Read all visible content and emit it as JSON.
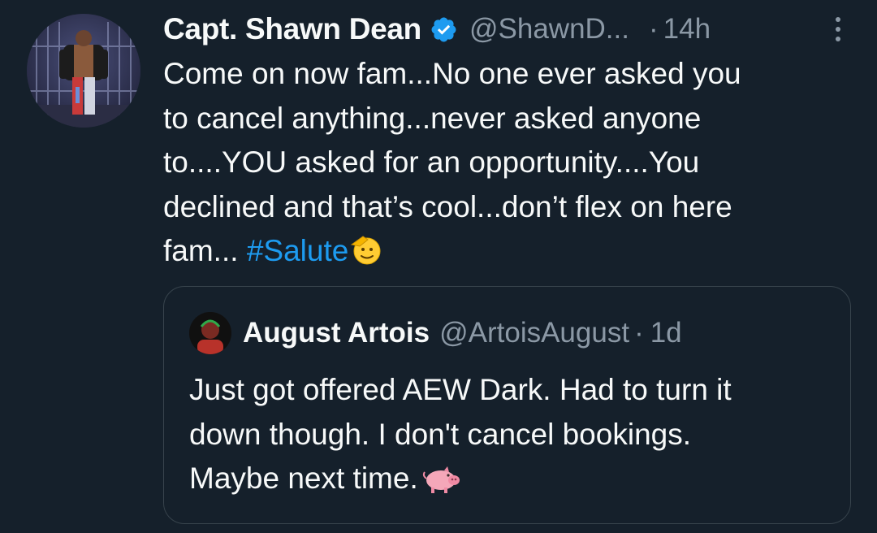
{
  "tweet": {
    "author_name": "Capt. Shawn Dean",
    "author_handle": "@ShawnD...",
    "separator": "·",
    "time": "14h",
    "text_lines": [
      "Come on now fam...No one ever asked you",
      "to cancel anything...never asked anyone",
      "to....YOU asked for an opportunity....You",
      "declined and that’s cool...don’t flex on here",
      "fam..."
    ],
    "hashtag": "#Salute",
    "emoji": "saluting-face",
    "icons": [
      "verified-badge-icon",
      "more-options-icon"
    ]
  },
  "quote": {
    "author_name": "August Artois",
    "author_handle": "@ArtoisAugust",
    "separator": "·",
    "time": "1d",
    "text_lines": [
      "Just got offered AEW Dark. Had to turn it",
      "down though. I don't cancel bookings.",
      "Maybe next time."
    ],
    "emoji": "pig"
  },
  "colors": {
    "background": "#15202b",
    "text": "#f7f9f9",
    "muted": "#8b98a5",
    "accent": "#1d9bf0",
    "border": "#38444d"
  }
}
